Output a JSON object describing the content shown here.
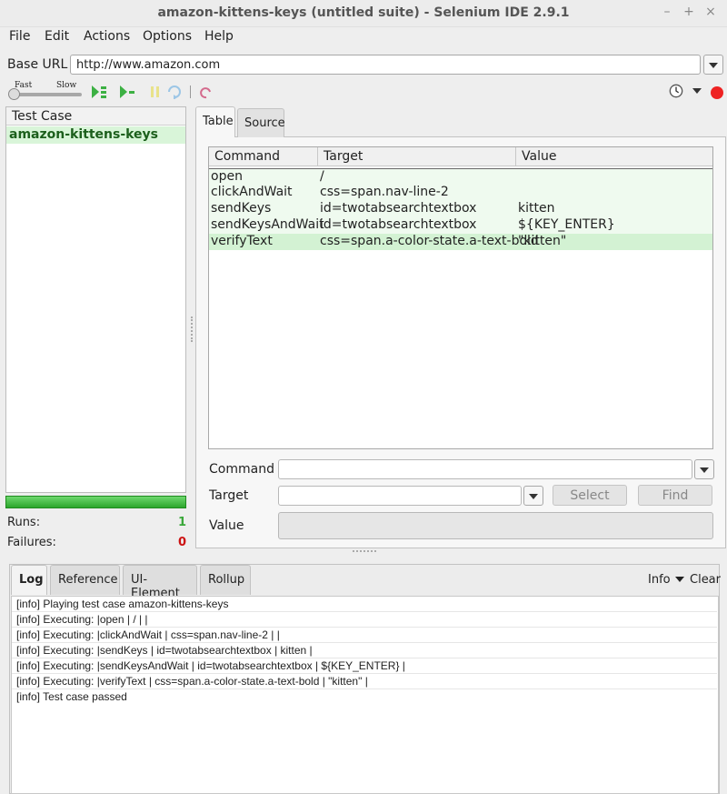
{
  "window": {
    "title": "amazon-kittens-keys (untitled suite) - Selenium IDE 2.9.1",
    "controls": [
      "–",
      "+",
      "×"
    ]
  },
  "menu": {
    "file": "File",
    "edit": "Edit",
    "actions": "Actions",
    "options": "Options",
    "help": "Help"
  },
  "base_url": {
    "label": "Base URL",
    "value": "http://www.amazon.com"
  },
  "toolbar": {
    "fast": "Fast",
    "slow": "Slow"
  },
  "test_case_panel": {
    "header": "Test Case",
    "items": [
      "amazon-kittens-keys"
    ],
    "runs_label": "Runs:",
    "runs_value": "1",
    "failures_label": "Failures:",
    "failures_value": "0"
  },
  "editor": {
    "tabs": [
      "Table",
      "Source"
    ],
    "columns": [
      "Command",
      "Target",
      "Value"
    ],
    "rows": [
      {
        "command": "open",
        "target": "/",
        "value": ""
      },
      {
        "command": "clickAndWait",
        "target": "css=span.nav-line-2",
        "value": ""
      },
      {
        "command": "sendKeys",
        "target": "id=twotabsearchtextbox",
        "value": "kitten"
      },
      {
        "command": "sendKeysAndWait",
        "target": "id=twotabsearchtextbox",
        "value": "${KEY_ENTER}"
      },
      {
        "command": "verifyText",
        "target": "css=span.a-color-state.a-text-bold",
        "value": "\"kitten\""
      }
    ],
    "command_label": "Command",
    "target_label": "Target",
    "value_label": "Value",
    "select_button": "Select",
    "find_button": "Find"
  },
  "log": {
    "tabs": [
      "Log",
      "Reference",
      "UI-Element",
      "Rollup"
    ],
    "level": "Info",
    "clear": "Clear",
    "lines": [
      "[info] Playing test case amazon-kittens-keys",
      "[info] Executing: |open | / | |",
      "[info] Executing: |clickAndWait | css=span.nav-line-2 | |",
      "[info] Executing: |sendKeys | id=twotabsearchtextbox | kitten |",
      "[info] Executing: |sendKeysAndWait | id=twotabsearchtextbox | ${KEY_ENTER} |",
      "[info] Executing: |verifyText | css=span.a-color-state.a-text-bold | \"kitten\" |",
      "[info] Test case passed"
    ]
  }
}
